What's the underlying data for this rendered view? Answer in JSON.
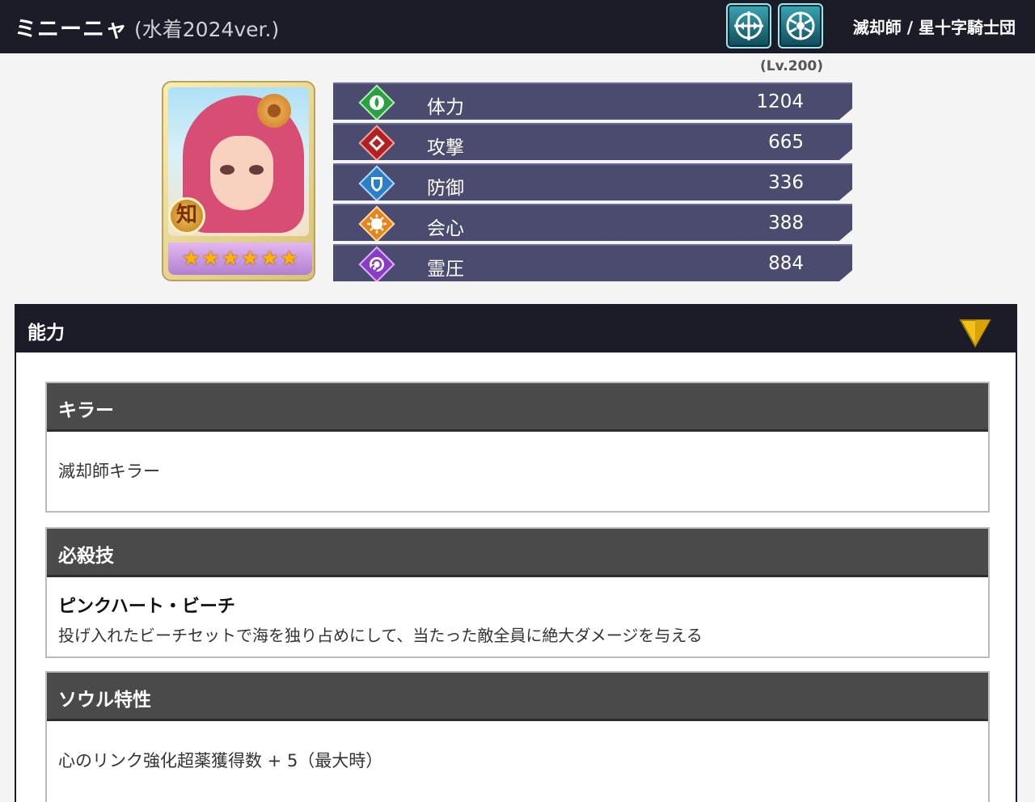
{
  "header": {
    "name": "ミニーニャ",
    "version": "(水着2024ver.)",
    "affiliation": "滅却師 / 星十字騎士団",
    "icons": [
      "crosshair-icon",
      "wheel-icon"
    ]
  },
  "level": "(Lv.200)",
  "card": {
    "attribute": "知",
    "stars": [
      "★",
      "★",
      "★",
      "★",
      "★",
      "★"
    ]
  },
  "stats": [
    {
      "label": "体力",
      "value": "1204",
      "icon": "water-drop-icon",
      "color": "#2e9e43"
    },
    {
      "label": "攻撃",
      "value": "665",
      "icon": "attack-diamond-icon",
      "color": "#b32020"
    },
    {
      "label": "防御",
      "value": "336",
      "icon": "shield-icon",
      "color": "#2a7fc8"
    },
    {
      "label": "会心",
      "value": "388",
      "icon": "sun-icon",
      "color": "#e8841a"
    },
    {
      "label": "霊圧",
      "value": "884",
      "icon": "spiral-icon",
      "color": "#8a3cc4"
    }
  ],
  "ability": {
    "title": "能力",
    "killer": {
      "title": "キラー",
      "text": "滅却師キラー"
    },
    "special": {
      "title": "必殺技",
      "name": "ピンクハート・ビーチ",
      "description": "投げ入れたビーチセットで海を独り占めにして、当たった敵全員に絶大ダメージを与える"
    },
    "soul": {
      "title": "ソウル特性",
      "text": "心のリンク強化超薬獲得数 + 5（最大時）"
    }
  }
}
